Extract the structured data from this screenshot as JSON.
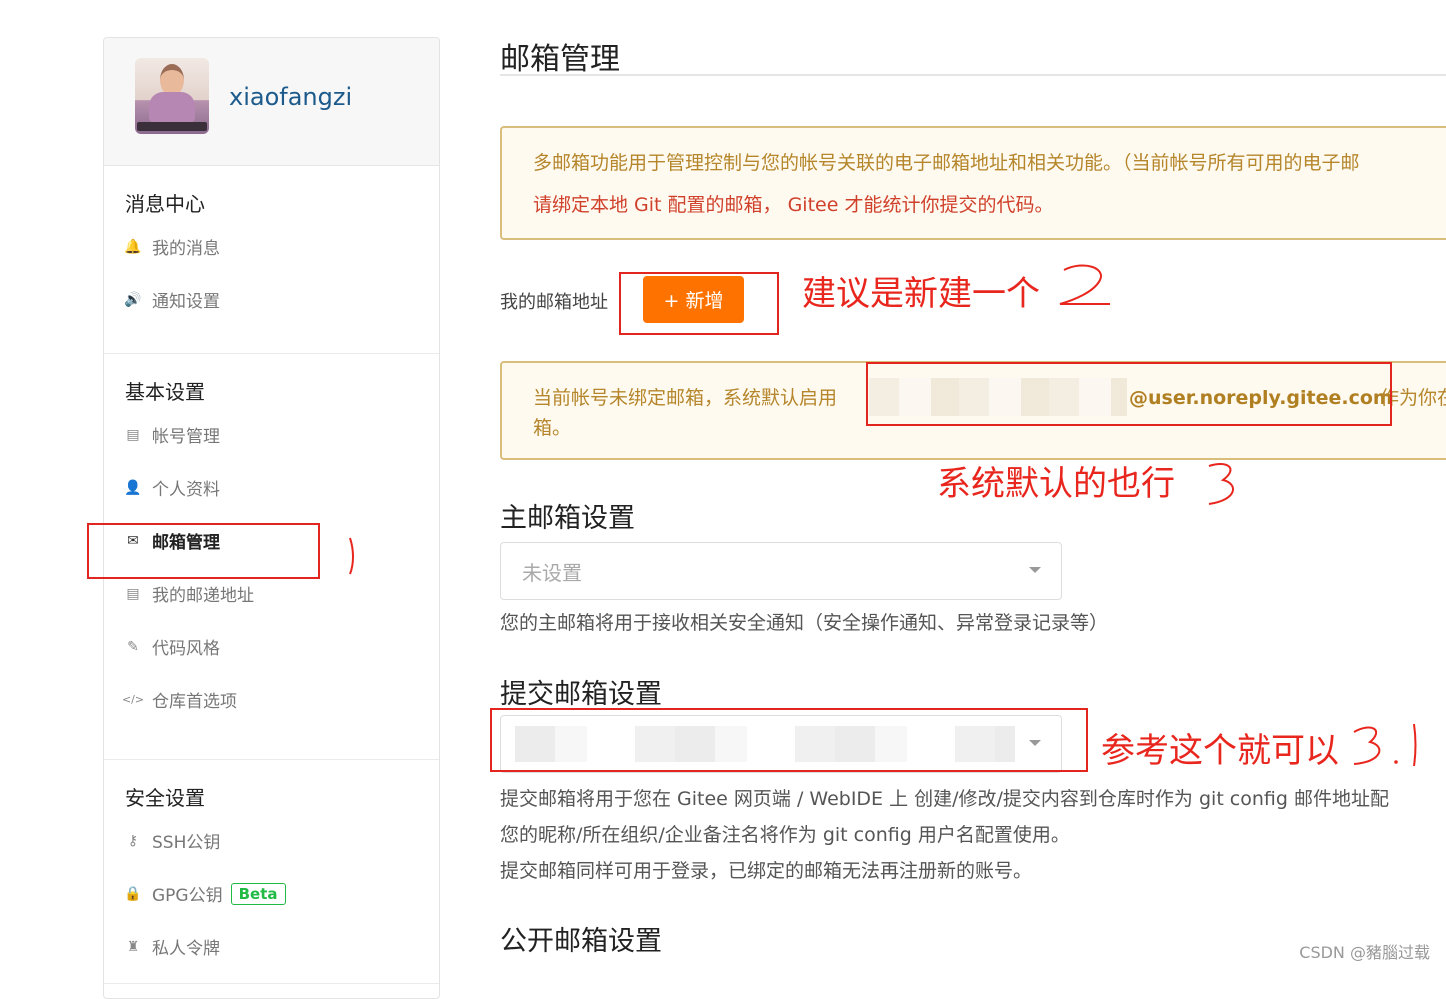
{
  "sidebar": {
    "username": "xiaofangzi",
    "sections": [
      {
        "title": "消息中心",
        "items": [
          {
            "label": "我的消息",
            "icon": "bell-icon"
          },
          {
            "label": "通知设置",
            "icon": "speaker-icon"
          }
        ]
      },
      {
        "title": "基本设置",
        "items": [
          {
            "label": "帐号管理",
            "icon": "id-card-icon"
          },
          {
            "label": "个人资料",
            "icon": "user-icon"
          },
          {
            "label": "邮箱管理",
            "icon": "envelope-icon",
            "active": true
          },
          {
            "label": "我的邮递地址",
            "icon": "address-card-icon"
          },
          {
            "label": "代码风格",
            "icon": "paintbrush-icon"
          },
          {
            "label": "仓库首选项",
            "icon": "code-icon"
          }
        ]
      },
      {
        "title": "安全设置",
        "items": [
          {
            "label": "SSH公钥",
            "icon": "key-icon"
          },
          {
            "label": "GPG公钥",
            "icon": "lock-icon",
            "badge": "Beta"
          },
          {
            "label": "私人令牌",
            "icon": "token-icon"
          }
        ]
      }
    ]
  },
  "main": {
    "title": "邮箱管理",
    "notice1": {
      "line1": "多邮箱功能用于管理控制与您的帐号关联的电子邮箱地址和相关功能。（当前帐号所有可用的电子邮",
      "line2": "请绑定本地 Git 配置的邮箱， Gitee 才能统计你提交的代码。"
    },
    "my_email_label": "我的邮箱地址",
    "add_button": "+ 新增",
    "notice2": {
      "prefix": "当前帐号未绑定邮箱，系统默认启用",
      "email": "@user.noreply.gitee.com",
      "suffix": "作为你在",
      "line2": "箱。"
    },
    "primary": {
      "heading": "主邮箱设置",
      "select_value": "未设置",
      "desc": "您的主邮箱将用于接收相关安全通知（安全操作通知、异常登录记录等）"
    },
    "commit": {
      "heading": "提交邮箱设置",
      "desc1": "提交邮箱将用于您在 Gitee 网页端 / WebIDE 上 创建/修改/提交内容到仓库时作为 git config 邮件地址配",
      "desc2": "您的昵称/所在组织/企业备注名将作为 git config 用户名配置使用。",
      "desc3": "提交邮箱同样可用于登录，已绑定的邮箱无法再注册新的账号。"
    },
    "public": {
      "heading": "公开邮箱设置"
    }
  },
  "annotations": {
    "a1": "建议是新建一个",
    "a2": "系统默认的也行",
    "a3": "参考这个就可以",
    "color": "#e8261d"
  },
  "watermark": "CSDN @豬腦过载",
  "colors": {
    "accent": "#fe7300",
    "notice_border": "#d9bd7a",
    "notice_text": "#b5862b",
    "link": "#1c5a8c"
  }
}
